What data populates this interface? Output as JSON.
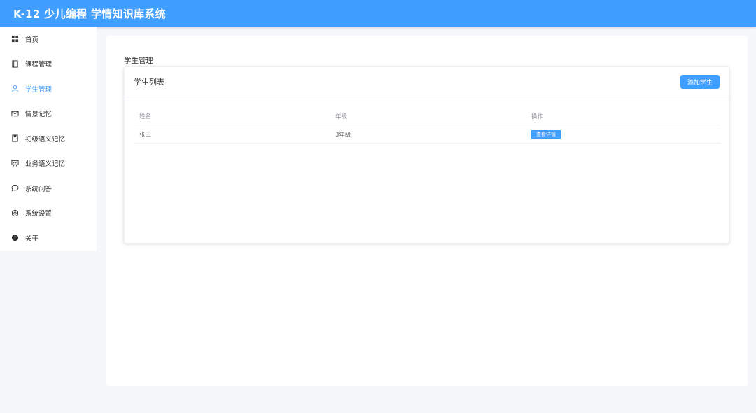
{
  "app": {
    "title": "K-12 少儿编程 学情知识库系统"
  },
  "sidebar": {
    "items": [
      {
        "label": "首页",
        "icon": "grid-icon",
        "active": false
      },
      {
        "label": "课程管理",
        "icon": "book-icon",
        "active": false
      },
      {
        "label": "学生管理",
        "icon": "user-icon",
        "active": true
      },
      {
        "label": "情景记忆",
        "icon": "mail-icon",
        "active": false
      },
      {
        "label": "初级语义记忆",
        "icon": "notebook-icon",
        "active": false
      },
      {
        "label": "业务语义记忆",
        "icon": "presentation-icon",
        "active": false
      },
      {
        "label": "系统问答",
        "icon": "chat-bubble-icon",
        "active": false
      },
      {
        "label": "系统设置",
        "icon": "gear-icon",
        "active": false
      },
      {
        "label": "关于",
        "icon": "info-icon",
        "active": false
      }
    ]
  },
  "main": {
    "section_title": "学生管理",
    "card": {
      "title": "学生列表",
      "add_button": "添加学生",
      "table": {
        "headers": [
          "姓名",
          "年级",
          "操作"
        ],
        "rows": [
          {
            "name": "张三",
            "grade": "3年级",
            "action": "查看详情"
          }
        ]
      }
    }
  },
  "colors": {
    "primary": "#409eff",
    "background": "#f5f7fa",
    "text": "#303133"
  }
}
